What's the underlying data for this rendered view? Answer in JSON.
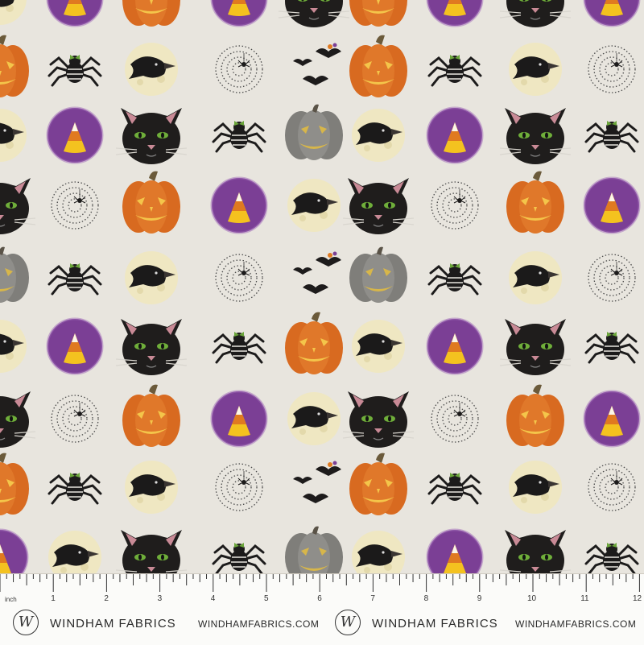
{
  "colors": {
    "background": "#e8e5de",
    "cat": "#1f1d1c",
    "cat_eye": "#6fae3a",
    "cat_nose": "#c98a96",
    "moon": "#efe7c2",
    "crow": "#1b1a1a",
    "candy_circle": "#7b3f95",
    "candy_yellow": "#f4c21f",
    "candy_orange": "#e07a20",
    "candy_white": "#fbf7e8",
    "pumpkin": "#e0782a",
    "pumpkin_glow": "#f4c54a",
    "gray_pumpkin": "#8f8e8a",
    "web_line": "#4a4a4a",
    "spider": "#1c1b1b",
    "bat": "#1d1b1b"
  },
  "pattern": {
    "motifs": [
      "cat-face",
      "moon-crow",
      "candy-corn",
      "jack-o-lantern",
      "spider",
      "spiderweb",
      "bats",
      "gray-pumpkin"
    ]
  },
  "ruler": {
    "unit_label": "inch",
    "numbers": [
      "1",
      "2",
      "3",
      "4",
      "5",
      "6",
      "7",
      "8",
      "9",
      "10",
      "11",
      "12"
    ],
    "brand": "WINDHAM FABRICS",
    "url": "WINDHAMFABRICS.COM",
    "logo_letter": "W"
  }
}
